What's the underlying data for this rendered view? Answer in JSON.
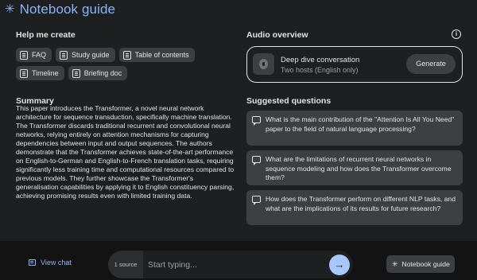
{
  "header": {
    "title": "Notebook guide",
    "icon": "sparkle-icon"
  },
  "help": {
    "label": "Help me create",
    "chips": [
      {
        "label": "FAQ"
      },
      {
        "label": "Study guide"
      },
      {
        "label": "Table of contents"
      },
      {
        "label": "Timeline"
      },
      {
        "label": "Briefing doc"
      }
    ]
  },
  "summary": {
    "label": "Summary",
    "text": "This paper introduces the Transformer, a novel neural network architecture for sequence transduction, specifically machine translation. The Transformer discards traditional recurrent and convolutional neural networks, relying entirely on attention mechanisms for capturing dependencies between input and output sequences. The authors demonstrate that the Transformer achieves state-of-the-art performance on English-to-German and English-to-French translation tasks, requiring significantly less training time and computational resources compared to previous models. They further showcase the Transformer's generalisation capabilities by applying it to English constituency parsing, achieving promising results even with limited training data."
  },
  "audio": {
    "label": "Audio overview",
    "title": "Deep dive conversation",
    "subtitle": "Two hosts (English only)",
    "generate_label": "Generate"
  },
  "questions": {
    "label": "Suggested questions",
    "items": [
      {
        "text": "What is the main contribution of the \"Attention Is All You Need\" paper to the field of natural language processing?"
      },
      {
        "text": "What are the limitations of recurrent neural networks in sequence modeling and how does the Transformer overcome them?"
      },
      {
        "text": "How does the Transformer perform on different NLP tasks, and what are the implications of its results for future research?"
      }
    ]
  },
  "footer": {
    "view_chat": "View chat",
    "source_count": "1 source",
    "input_placeholder": "Start typing...",
    "notebook_guide_label": "Notebook guide"
  },
  "colors": {
    "accent": "#8ab4f8",
    "send": "#a8c7fa",
    "background": "#1e1f20"
  }
}
